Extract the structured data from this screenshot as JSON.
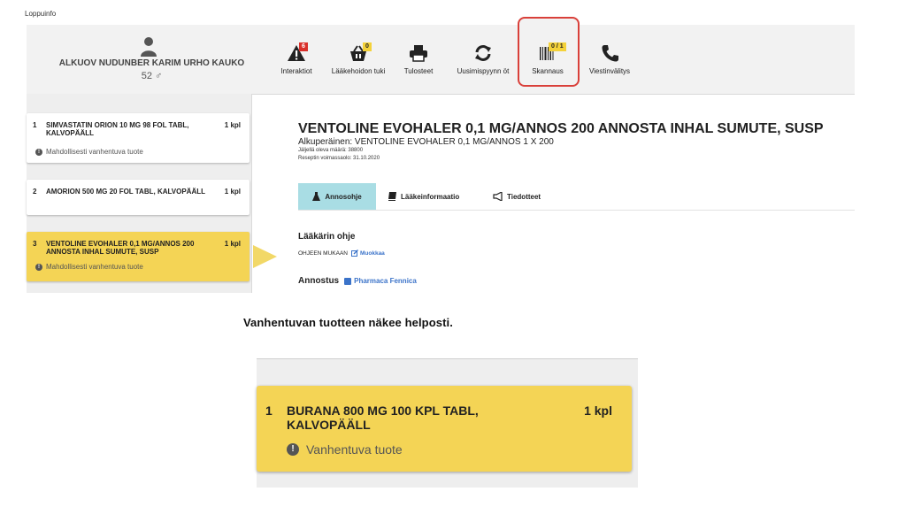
{
  "app": {
    "title": "Loppuinfo"
  },
  "patient": {
    "name": "ALKUOV NUDUNBER KARIM URHO KAUKO",
    "age": "52 ♂"
  },
  "toolbar": [
    {
      "id": "interaktiot",
      "label": "Interaktiot",
      "badge": "6",
      "icon": "warning-icon"
    },
    {
      "id": "laakehoidon",
      "label": "Lääkehoidon tuki",
      "badge": "0",
      "icon": "basket-icon"
    },
    {
      "id": "tulosteet",
      "label": "Tulosteet",
      "icon": "printer-icon"
    },
    {
      "id": "uusimispyynnot",
      "label": "Uusimispyynn öt",
      "icon": "refresh-icon"
    },
    {
      "id": "skannaus",
      "label": "Skannaus",
      "badge": "0 / 1",
      "icon": "barcode-icon"
    },
    {
      "id": "viestinvalitys",
      "label": "Viestinvälitys",
      "icon": "phone-icon"
    }
  ],
  "list": {
    "items": [
      {
        "num": "1",
        "name": "SIMVASTATIN ORION 10 MG 98 FOL TABL, KALVOPÄÄLL",
        "qty": "1 kpl",
        "warning": "Mahdollisesti vanhentuva tuote"
      },
      {
        "num": "2",
        "name": "AMORION 500 MG 20 FOL TABL, KALVOPÄÄLL",
        "qty": "1 kpl"
      },
      {
        "num": "3",
        "name": "VENTOLINE EVOHALER 0,1 MG/ANNOS 200 ANNOSTA INHAL SUMUTE, SUSP",
        "qty": "1 kpl",
        "warning": "Mahdollisesti vanhentuva tuote"
      }
    ]
  },
  "detail": {
    "title": "VENTOLINE EVOHALER 0,1 MG/ANNOS 200 ANNOSTA INHAL SUMUTE, SUSP",
    "original": "Alkuperäinen: VENTOLINE EVOHALER 0,1 MG/ANNOS 1 X 200",
    "remaining": "Jäljellä oleva määrä: 38800",
    "validity": "Reseptin voimassaolo: 31.10.2020",
    "tabs": [
      {
        "label": "Annosohje",
        "icon": "flask-icon"
      },
      {
        "label": "Lääkeinformaatio",
        "icon": "book-icon"
      },
      {
        "label": "Tiedotteet",
        "icon": "megaphone-icon"
      }
    ],
    "doctor_heading": "Lääkärin ohje",
    "doctor_text": "OHJEEN MUKAAN",
    "edit_link": "Muokkaa",
    "dosage_heading": "Annostus",
    "dosage_link": "Pharmaca Fennica"
  },
  "caption": "Vanhentuvan tuotteen näkee helposti.",
  "zoom": {
    "num": "1",
    "name": "BURANA 800 MG 100 KPL TABL, KALVOPÄÄLL",
    "qty": "1 kpl",
    "warning": "Vanhentuva tuote"
  },
  "colors": {
    "highlight": "#f4d455",
    "tab_active": "#a9dde4",
    "badge_red": "#d9302b",
    "badge_yellow": "#f4d23a",
    "link": "#3b73c9"
  }
}
